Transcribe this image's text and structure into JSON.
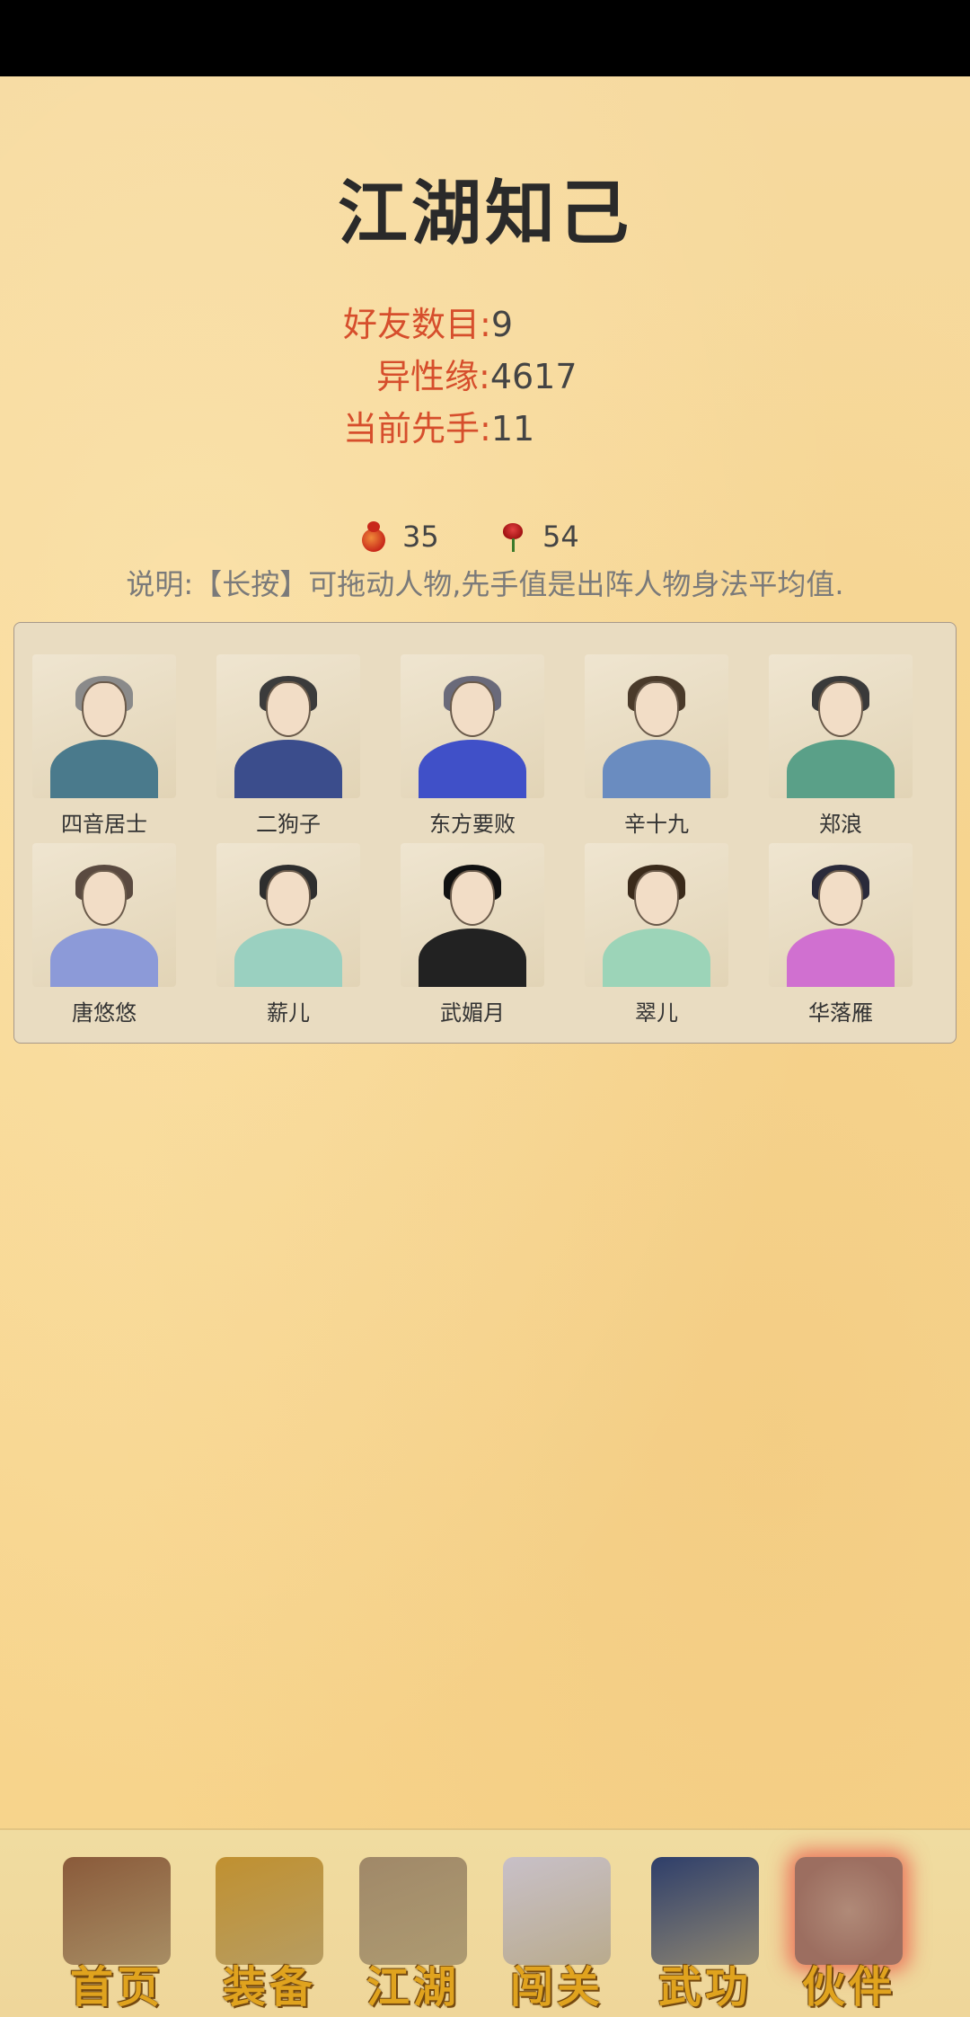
{
  "page": {
    "title": "江湖知己",
    "stats": [
      {
        "label": "好友数目",
        "sep": ":",
        "value": "9"
      },
      {
        "label": "异性缘",
        "sep": ":",
        "value": "4617"
      },
      {
        "label": "当前先手",
        "sep": ":",
        "value": "11"
      }
    ],
    "currency": [
      {
        "icon": "gourd-icon",
        "value": "35"
      },
      {
        "icon": "rose-icon",
        "value": "54"
      }
    ],
    "note": "说明:【长按】可拖动人物,先手值是出阵人物身法平均值."
  },
  "members": [
    {
      "name": "四音居士",
      "hair": "#8a8a8a",
      "body": "#4a7a8c"
    },
    {
      "name": "二狗子",
      "hair": "#3b3b3b",
      "body": "#3b4d8c"
    },
    {
      "name": "东方要败",
      "hair": "#6a6a7a",
      "body": "#4050c8"
    },
    {
      "name": "辛十九",
      "hair": "#4a3a2a",
      "body": "#6a8cc0"
    },
    {
      "name": "郑浪",
      "hair": "#3a3a3a",
      "body": "#5aa088"
    },
    {
      "name": "唐悠悠",
      "hair": "#5a4a40",
      "body": "#8c9ad8"
    },
    {
      "name": "薪儿",
      "hair": "#2e2e2e",
      "body": "#9ad0c0"
    },
    {
      "name": "武媚月",
      "hair": "#111111",
      "body": "#222222"
    },
    {
      "name": "翠儿",
      "hair": "#3a2a1a",
      "body": "#9cd4b8"
    },
    {
      "name": "华落雁",
      "hair": "#2a2a3a",
      "body": "#d070d0"
    }
  ],
  "nav": [
    {
      "label": "首页",
      "art": "#8a5a3a",
      "active": false
    },
    {
      "label": "装备",
      "art": "#c09030",
      "active": false
    },
    {
      "label": "江湖",
      "art": "#a08868",
      "active": false
    },
    {
      "label": "闯关",
      "art": "#c8c0c8",
      "active": false
    },
    {
      "label": "武功",
      "art": "#2e3e6a",
      "active": false
    },
    {
      "label": "伙伴",
      "art": "#9c6e60",
      "active": true
    }
  ],
  "colors": {
    "accent_label": "#d64e2c",
    "background": "#f7d58f",
    "panel": "#e9dcc1"
  }
}
